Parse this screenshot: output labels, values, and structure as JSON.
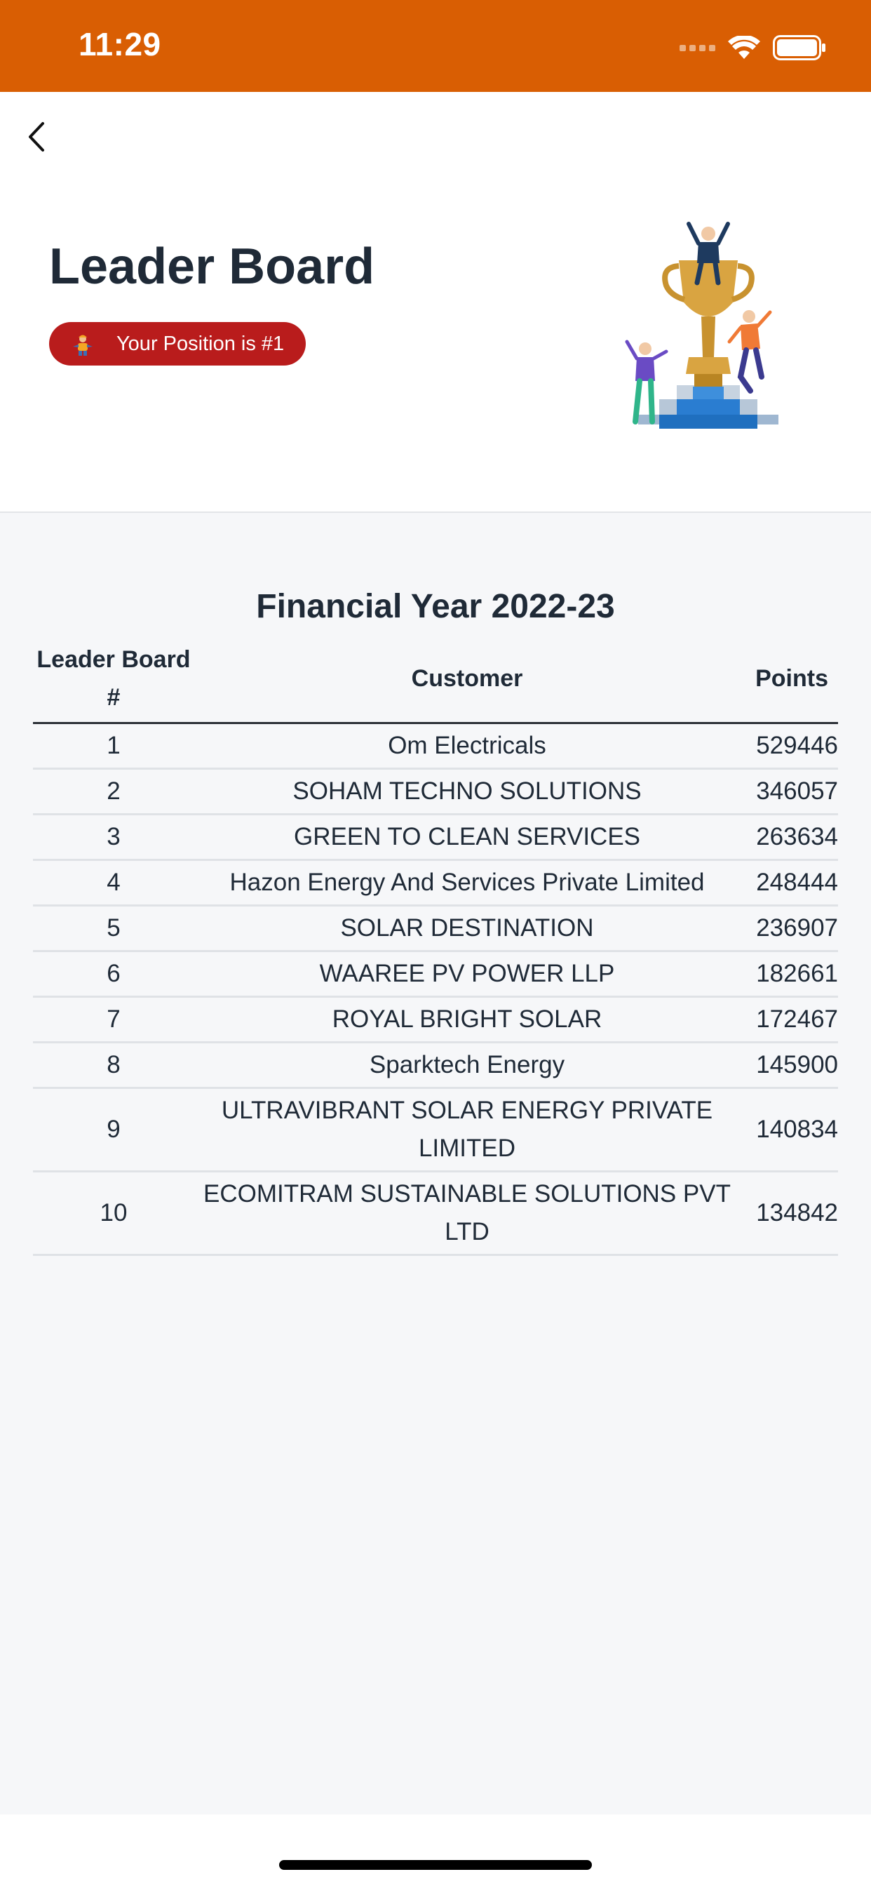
{
  "status_bar": {
    "time": "11:29",
    "icons": [
      "signal-icon",
      "wifi-icon",
      "battery-icon"
    ],
    "bg_color": "#d95e03"
  },
  "header": {
    "back_icon": "chevron-left-icon",
    "title": "Leader Board",
    "badge": {
      "text": "Your Position is #1",
      "icon": "worker-icon",
      "color": "#b91c1c"
    },
    "illustration": "trophy-podium-illustration"
  },
  "leaderboard": {
    "financial_year": "Financial Year 2022-23",
    "columns": {
      "rank_line1": "Leader Board",
      "rank_line2": "#",
      "customer": "Customer",
      "points": "Points"
    },
    "rows": [
      {
        "rank": "1",
        "customer": "Om Electricals",
        "points": "529446"
      },
      {
        "rank": "2",
        "customer": "SOHAM TECHNO SOLUTIONS",
        "points": "346057"
      },
      {
        "rank": "3",
        "customer": "GREEN TO CLEAN SERVICES",
        "points": "263634"
      },
      {
        "rank": "4",
        "customer": "Hazon Energy And Services Private Limited",
        "points": "248444"
      },
      {
        "rank": "5",
        "customer": "SOLAR DESTINATION",
        "points": "236907"
      },
      {
        "rank": "6",
        "customer": "WAAREE PV POWER LLP",
        "points": "182661"
      },
      {
        "rank": "7",
        "customer": "ROYAL BRIGHT SOLAR",
        "points": "172467"
      },
      {
        "rank": "8",
        "customer": "Sparktech Energy",
        "points": "145900"
      },
      {
        "rank": "9",
        "customer": "ULTRAVIBRANT SOLAR ENERGY PRIVATE LIMITED",
        "points": "140834"
      },
      {
        "rank": "10",
        "customer": "ECOMITRAM SUSTAINABLE SOLUTIONS PVT LTD",
        "points": "134842"
      }
    ]
  }
}
